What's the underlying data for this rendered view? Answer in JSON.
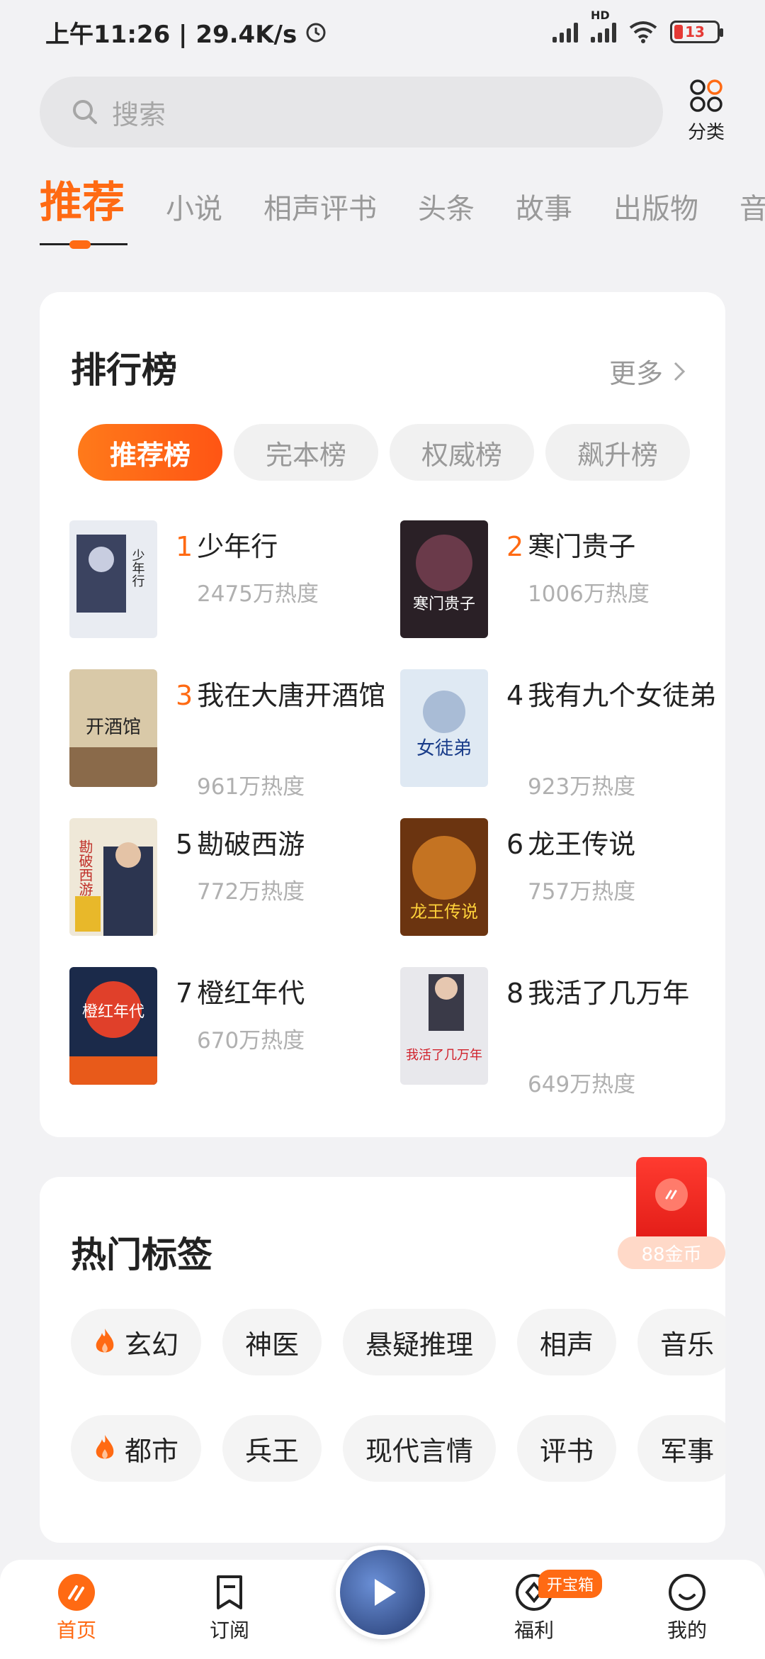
{
  "status": {
    "time": "上午11:26 | 29.4K/s",
    "battery": "13",
    "network_label": "HD"
  },
  "search": {
    "placeholder": "搜索"
  },
  "category_button": {
    "label": "分类"
  },
  "tabs": [
    "推荐",
    "小说",
    "相声评书",
    "头条",
    "故事",
    "出版物",
    "音"
  ],
  "ranking": {
    "title": "排行榜",
    "more_label": "更多",
    "chips": [
      "推荐榜",
      "完本榜",
      "权威榜",
      "飙升榜"
    ],
    "books": [
      {
        "rank": "1",
        "title": "少年行",
        "heat": "2475万热度",
        "cover_text": "少年行"
      },
      {
        "rank": "2",
        "title": "寒门贵子",
        "heat": "1006万热度",
        "cover_text": "寒门贵子"
      },
      {
        "rank": "3",
        "title": "我在大唐开酒馆",
        "heat": "961万热度",
        "cover_text": "开酒馆"
      },
      {
        "rank": "4",
        "title": "我有九个女徒弟",
        "heat": "923万热度",
        "cover_text": "女徒弟"
      },
      {
        "rank": "5",
        "title": "勘破西游",
        "heat": "772万热度",
        "cover_text": "勘破西游"
      },
      {
        "rank": "6",
        "title": "龙王传说",
        "heat": "757万热度",
        "cover_text": "龙王传说"
      },
      {
        "rank": "7",
        "title": "橙红年代",
        "heat": "670万热度",
        "cover_text": "橙红年代"
      },
      {
        "rank": "8",
        "title": "我活了几万年",
        "heat": "649万热度",
        "cover_text": "我活了几万年"
      }
    ]
  },
  "hot_tags": {
    "title": "热门标签",
    "row1": [
      "玄幻",
      "神医",
      "悬疑推理",
      "相声",
      "音乐"
    ],
    "row2": [
      "都市",
      "兵王",
      "现代言情",
      "评书",
      "军事"
    ]
  },
  "red_packet": {
    "label": "88金币"
  },
  "bottom_nav": {
    "home": "首页",
    "subscribe": "订阅",
    "welfare": "福利",
    "welfare_badge": "开宝箱",
    "me": "我的"
  },
  "colors": {
    "accent": "#ff6a13",
    "red": "#e11b16"
  }
}
